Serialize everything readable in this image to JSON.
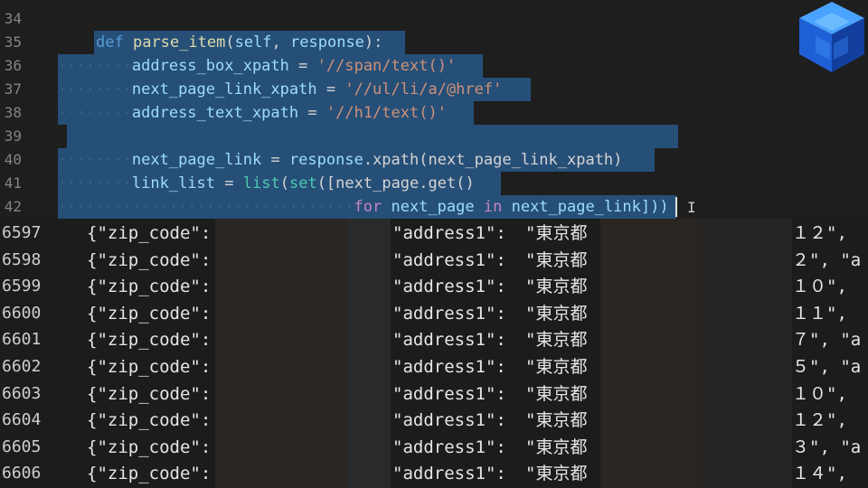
{
  "editor": {
    "lines": [
      {
        "num": "34"
      },
      {
        "num": "35",
        "kw_def": "def",
        "fn_name": "parse_item",
        "p_open": "(",
        "param_self": "self",
        "comma": ",",
        "param_response": "response",
        "p_close": "):"
      },
      {
        "num": "36",
        "var": "address_box_xpath",
        "eq": "=",
        "str": "'//span/text()'"
      },
      {
        "num": "37",
        "var": "next_page_link_xpath",
        "eq": "=",
        "str": "'//ul/li/a/@href'"
      },
      {
        "num": "38",
        "var": "address_text_xpath",
        "eq": "=",
        "str": "'//h1/text()'"
      },
      {
        "num": "39"
      },
      {
        "num": "40",
        "var": "next_page_link",
        "eq": "=",
        "obj": "response",
        "call": ".xpath(next_page_link_xpath)"
      },
      {
        "num": "41",
        "var": "link_list",
        "eq": "=",
        "fn_list": "list",
        "p1": "(",
        "fn_set": "set",
        "rest": "([next_page.get()"
      },
      {
        "num": "42",
        "kw_for": "for",
        "loop_var": "next_page",
        "kw_in": "in",
        "rest": "next_page_link]))"
      }
    ]
  },
  "data_view": {
    "rows": [
      {
        "num": "6597",
        "key1": "{\"zip_code\":",
        "key2": "\"address1\":",
        "jp": "\"東京都",
        "tail": "１２\","
      },
      {
        "num": "6598",
        "key1": "{\"zip_code\":",
        "key2": "\"address1\":",
        "jp": "\"東京都",
        "tail": "２\", \"a"
      },
      {
        "num": "6599",
        "key1": "{\"zip_code\":",
        "key2": "\"address1\":",
        "jp": "\"東京都",
        "tail": "１０\","
      },
      {
        "num": "6600",
        "key1": "{\"zip_code\":",
        "key2": "\"address1\":",
        "jp": "\"東京都",
        "tail": "１１\","
      },
      {
        "num": "6601",
        "key1": "{\"zip_code\":",
        "key2": "\"address1\":",
        "jp": "\"東京都",
        "tail": "７\", \"a"
      },
      {
        "num": "6602",
        "key1": "{\"zip_code\":",
        "key2": "\"address1\":",
        "jp": "\"東京都",
        "tail": "５\", \"a"
      },
      {
        "num": "6603",
        "key1": "{\"zip_code\":",
        "key2": "\"address1\":",
        "jp": "\"東京都",
        "tail": "１０\","
      },
      {
        "num": "6604",
        "key1": "{\"zip_code\":",
        "key2": "\"address1\":",
        "jp": "\"東京都",
        "tail": "１２\","
      },
      {
        "num": "6605",
        "key1": "{\"zip_code\":",
        "key2": "\"address1\":",
        "jp": "\"東京都",
        "tail": "３\", \"a"
      },
      {
        "num": "6606",
        "key1": "{\"zip_code\":",
        "key2": "\"address1\":",
        "jp": "\"東京都",
        "tail": "１４\","
      }
    ]
  },
  "colors": {
    "editor_bg": "#1e1e1e",
    "selection": "#264f78",
    "keyword": "#569cd6",
    "function": "#dcdcaa",
    "parameter": "#9cdcfe",
    "string": "#ce9178",
    "builtin": "#4ec9b0",
    "control": "#c586c0"
  },
  "icons": {
    "logo": "blue-cube-logo-icon",
    "cursor": "text-ibeam-cursor-icon"
  }
}
